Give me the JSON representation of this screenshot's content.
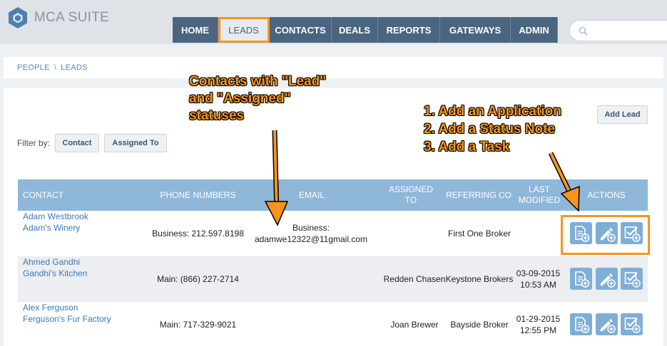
{
  "app": {
    "name": "MCA SUITE"
  },
  "nav": [
    "HOME",
    "LEADS",
    "CONTACTS",
    "DEALS",
    "REPORTS",
    "GATEWAYS",
    "ADMIN"
  ],
  "search": {
    "placeholder": ""
  },
  "breadcrumb": {
    "root": "PEOPLE",
    "sep": "\\",
    "current": "LEADS"
  },
  "filter": {
    "label": "Filter by:",
    "contact": "Contact",
    "assigned": "Assigned To"
  },
  "add_lead": "Add Lead",
  "table": {
    "headers": [
      "CONTACT",
      "PHONE NUMBERS",
      "EMAIL",
      "ASSIGNED TO",
      "REFERRING CO",
      "LAST MODIFIED",
      "ACTIONS"
    ],
    "rows": [
      {
        "name": "Adam Westbrook",
        "company": "Adam's Winery",
        "phone": "Business: 212.597.8198",
        "email_label": "Business:",
        "email": "adamwe12322@11gmail.com",
        "assigned": "",
        "referring": "First One Broker",
        "modified_date": "",
        "modified_time": ""
      },
      {
        "name": "Ahmed Gandhi",
        "company": "Gandhi's Kitchen",
        "phone": "Main: (866) 227-2714",
        "email_label": "",
        "email": "",
        "assigned": "Redden Chasen",
        "referring": "Keystone Brokers",
        "modified_date": "03-09-2015",
        "modified_time": "10:53 AM"
      },
      {
        "name": "Alex Ferguson",
        "company": "Ferguson's Fur Factory",
        "phone": "Main: 717-329-9021",
        "email_label": "",
        "email": "",
        "assigned": "Joan Brewer",
        "referring": "Bayside Broker",
        "modified_date": "01-29-2015",
        "modified_time": "12:55 PM"
      }
    ]
  },
  "annotations": {
    "statuses": [
      "Contacts with \"Lead\"",
      "and \"Assigned\"",
      "statuses"
    ],
    "actions": [
      "1.  Add an Application",
      "2.  Add a Status Note",
      "3.  Add a Task"
    ]
  },
  "colors": {
    "accent": "#f7941d",
    "nav": "#4a6580",
    "table_header": "#8eb7d9",
    "link": "#3a78b5"
  },
  "icons": [
    "logo-hexagon-icon",
    "search-icon",
    "add-application-icon",
    "add-note-icon",
    "add-task-icon"
  ]
}
